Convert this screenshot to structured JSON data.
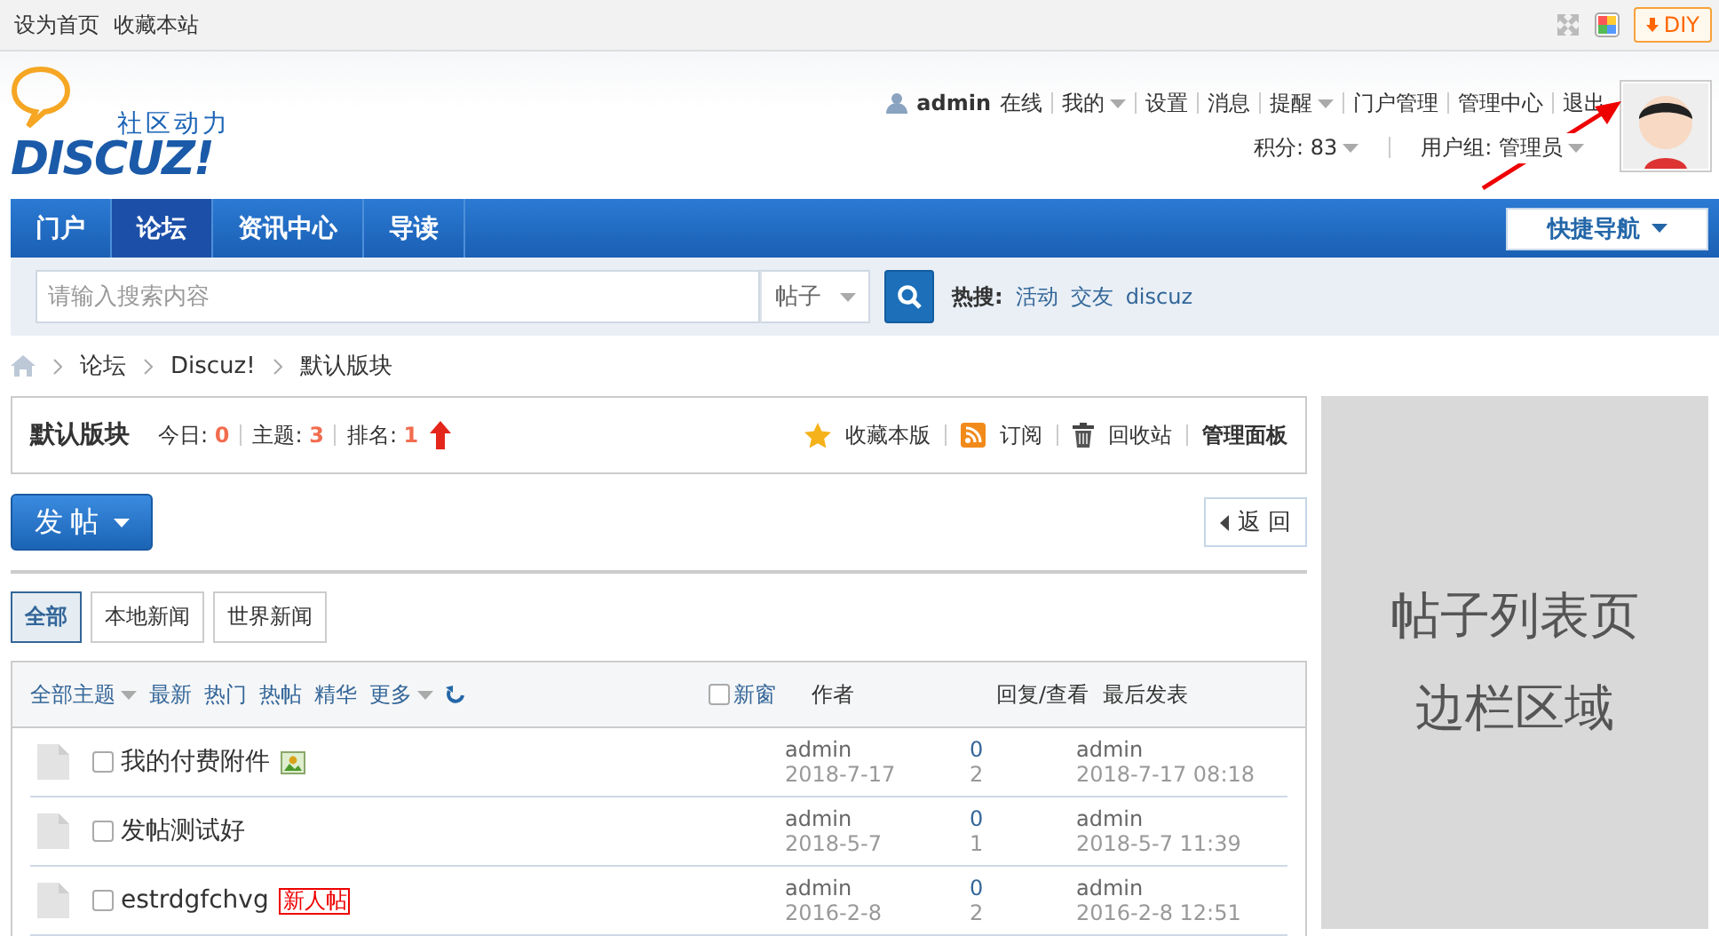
{
  "topbar": {
    "links": [
      "设为首页",
      "收藏本站"
    ],
    "diy": "DIY"
  },
  "header": {
    "logo_tagline": "社区动力",
    "logo_text": "DISCUZ!",
    "username": "admin",
    "status": "在线",
    "menu": [
      {
        "label": "我的",
        "dropdown": true
      },
      {
        "label": "设置",
        "dropdown": false
      },
      {
        "label": "消息",
        "dropdown": false
      },
      {
        "label": "提醒",
        "dropdown": true
      },
      {
        "label": "门户管理",
        "dropdown": false
      },
      {
        "label": "管理中心",
        "dropdown": false
      },
      {
        "label": "退出",
        "dropdown": false
      }
    ],
    "credits": "积分: 83",
    "usergroup": "用户组: 管理员"
  },
  "nav": {
    "tabs": [
      {
        "label": "门户",
        "selected": false
      },
      {
        "label": "论坛",
        "selected": true
      },
      {
        "label": "资讯中心",
        "selected": false
      },
      {
        "label": "导读",
        "selected": false
      }
    ],
    "quick_nav": "快捷导航"
  },
  "search": {
    "placeholder": "请输入搜索内容",
    "type": "帖子",
    "hot_label": "热搜:",
    "hot": [
      "活动",
      "交友",
      "discuz"
    ]
  },
  "breadcrumb": [
    "论坛",
    "Discuz!",
    "默认版块"
  ],
  "forum": {
    "name": "默认版块",
    "stats": [
      {
        "label": "今日:",
        "value": "0"
      },
      {
        "label": "主题:",
        "value": "3"
      },
      {
        "label": "排名:",
        "value": "1"
      }
    ],
    "actions": [
      {
        "kind": "star",
        "label": "收藏本版"
      },
      {
        "kind": "rss",
        "label": "订阅"
      },
      {
        "kind": "trash",
        "label": "回收站"
      },
      {
        "kind": "bold",
        "label": "管理面板"
      }
    ]
  },
  "post_button": "发帖",
  "back_button": "返 回",
  "categories": [
    {
      "label": "全部",
      "selected": true
    },
    {
      "label": "本地新闻",
      "selected": false
    },
    {
      "label": "世界新闻",
      "selected": false
    }
  ],
  "thread_list": {
    "filters": [
      {
        "label": "全部主题",
        "dropdown": true
      },
      {
        "label": "最新",
        "dropdown": false
      },
      {
        "label": "热门",
        "dropdown": false
      },
      {
        "label": "热帖",
        "dropdown": false
      },
      {
        "label": "精华",
        "dropdown": false
      },
      {
        "label": "更多",
        "dropdown": true
      }
    ],
    "new_window": {
      "label": "新窗",
      "checked": false
    },
    "columns": [
      "作者",
      "回复/查看",
      "最后发表"
    ],
    "rows": [
      {
        "title": "我的付费附件",
        "badge": {
          "kind": "image"
        },
        "checked": false,
        "author": "admin",
        "date": "2018-7-17",
        "replies": "0",
        "views": "2",
        "last_author": "admin",
        "last_date": "2018-7-17 08:18"
      },
      {
        "title": "发帖测试好",
        "checked": false,
        "author": "admin",
        "date": "2018-5-7",
        "replies": "0",
        "views": "1",
        "last_author": "admin",
        "last_date": "2018-5-7 11:39"
      },
      {
        "title": "estrdgfchvg",
        "badge": {
          "kind": "label",
          "text": "新人帖"
        },
        "checked": false,
        "author": "admin",
        "date": "2016-2-8",
        "replies": "0",
        "views": "2",
        "last_author": "admin",
        "last_date": "2016-2-8 12:51"
      }
    ]
  },
  "sidebar": {
    "lines": [
      "帖子列表页",
      "边栏区域"
    ]
  }
}
